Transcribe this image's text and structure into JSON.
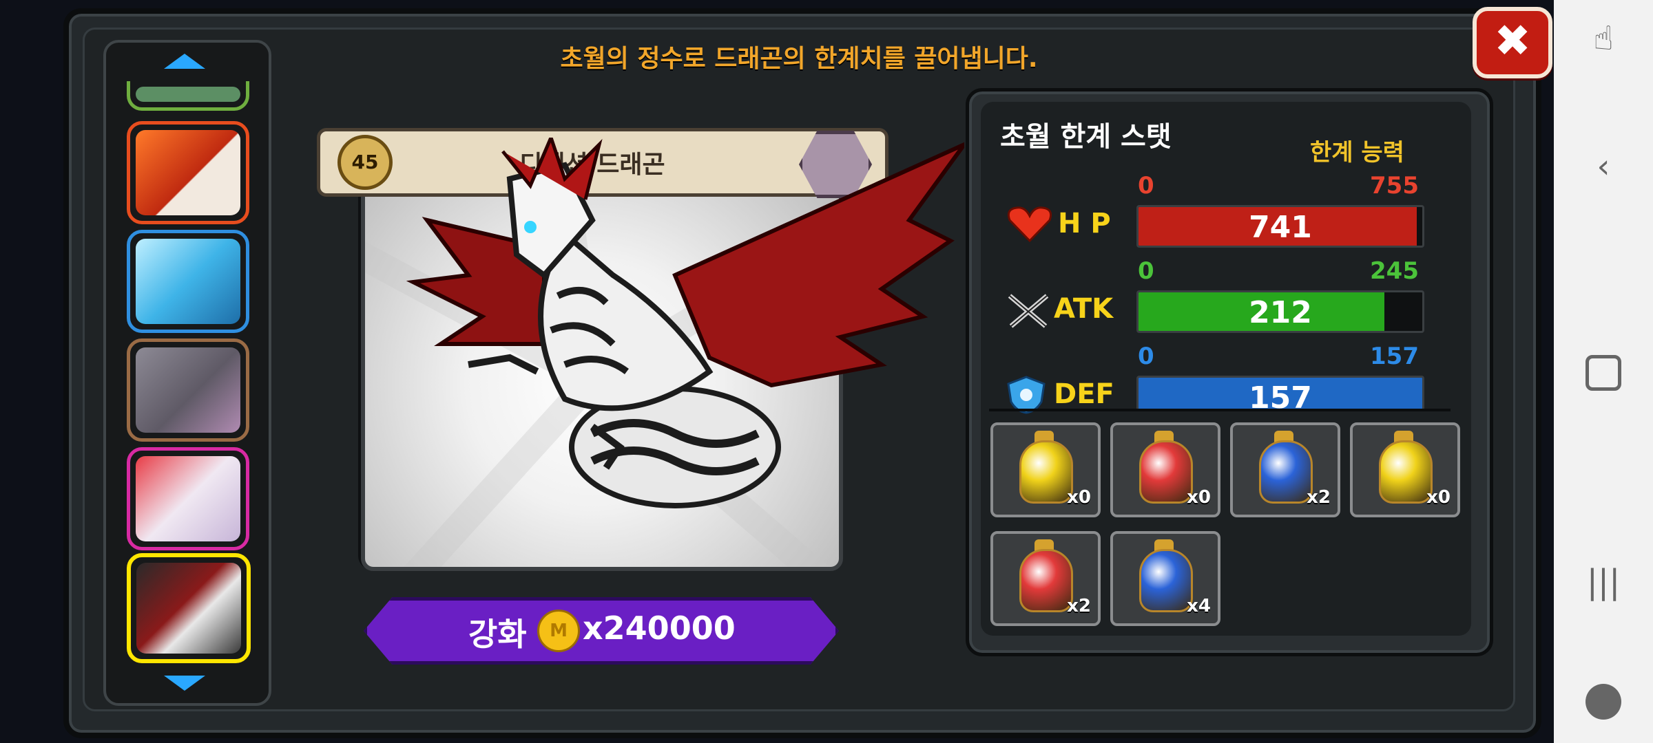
{
  "header": {
    "subtitle": "초월의 정수로 드래곤의 한계치를 끌어냅니다."
  },
  "close": {
    "symbol": "✖"
  },
  "dragon_list": {
    "thumbs": [
      {
        "name": "partial-dragon",
        "color": "#6fae3f"
      },
      {
        "name": "fire-dragon",
        "color": "#e84d1e"
      },
      {
        "name": "ice-dragon",
        "color": "#2f8fe0"
      },
      {
        "name": "rock-dragon",
        "color": "#9a6b45"
      },
      {
        "name": "pink-dragon",
        "color": "#d82aa3"
      },
      {
        "name": "dimension-dragon",
        "color": "#ffe600"
      }
    ]
  },
  "dragon": {
    "level": "45",
    "name": "디멘션 드래곤"
  },
  "upgrade": {
    "label": "강화",
    "coin": "M",
    "cost": "x240000"
  },
  "stats": {
    "title": "초월 한계 스탯",
    "limit_label": "한계 능력",
    "items": [
      {
        "label": "H P",
        "min": "0",
        "max": "755",
        "value": "741",
        "fill": 0.9815,
        "color": "#bf2017",
        "min_color": "#e8432f",
        "max_color": "#e8432f"
      },
      {
        "label": "ATK",
        "min": "0",
        "max": "245",
        "value": "212",
        "fill": 0.8653,
        "color": "#27a81d",
        "min_color": "#4bc33a",
        "max_color": "#4bc33a"
      },
      {
        "label": "DEF",
        "min": "0",
        "max": "157",
        "value": "157",
        "fill": 1.0,
        "color": "#1f68c4",
        "min_color": "#2d8be8",
        "max_color": "#2d8be8"
      }
    ]
  },
  "potions": [
    {
      "color": "#f0d21a",
      "count": "x0"
    },
    {
      "color": "#e23a3a",
      "count": "x0"
    },
    {
      "color": "#2b63d8",
      "count": "x2"
    },
    {
      "color": "#f0d21a",
      "count": "x0"
    },
    {
      "color": "#e23a3a",
      "count": "x2"
    },
    {
      "color": "#2b63d8",
      "count": "x4"
    }
  ],
  "system_nav": {
    "icons": [
      "touch-icon",
      "back-icon",
      "home-icon",
      "recents-icon",
      "game-icon"
    ]
  }
}
